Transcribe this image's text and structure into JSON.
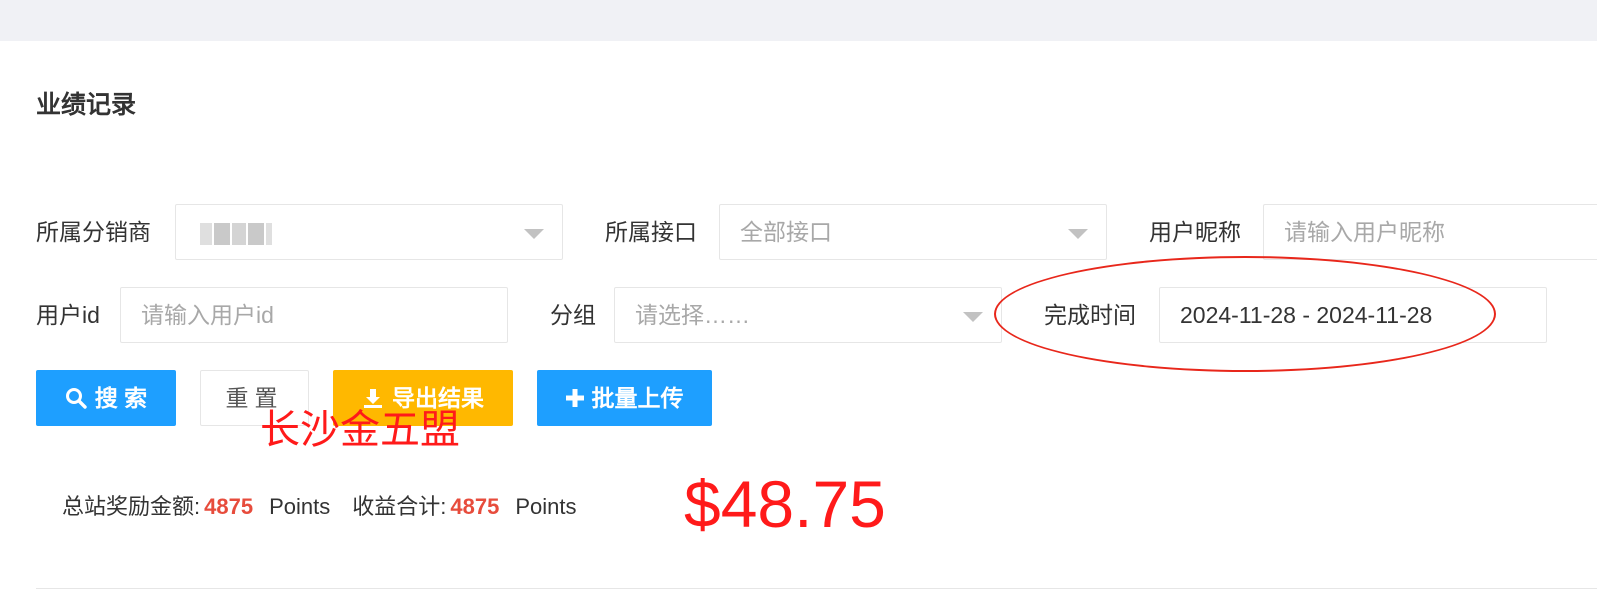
{
  "page": {
    "title": "业绩记录"
  },
  "filters": {
    "distributor_label": "所属分销商",
    "interface_label": "所属接口",
    "interface_value": "全部接口",
    "nickname_label": "用户昵称",
    "nickname_placeholder": "请输入用户昵称",
    "userid_label": "用户id",
    "userid_placeholder": "请输入用户id",
    "group_label": "分组",
    "group_placeholder": "请选择……",
    "time_label": "完成时间",
    "time_value": "2024-11-28 - 2024-11-28"
  },
  "buttons": {
    "search": "搜 索",
    "reset": "重置",
    "export": "导出结果",
    "upload": "批量上传"
  },
  "summary": {
    "total_reward_label": "总站奖励金额:",
    "total_reward_value": "4875",
    "total_reward_unit": "Points",
    "income_label": "收益合计:",
    "income_value": "4875",
    "income_unit": "Points"
  },
  "annotations": {
    "red_text": "长沙金五盟",
    "amount": "$48.75"
  },
  "colors": {
    "primary": "#1e9fff",
    "warning": "#ffb800",
    "highlight": "#e74c3c",
    "annotation": "#ff1a1a"
  }
}
